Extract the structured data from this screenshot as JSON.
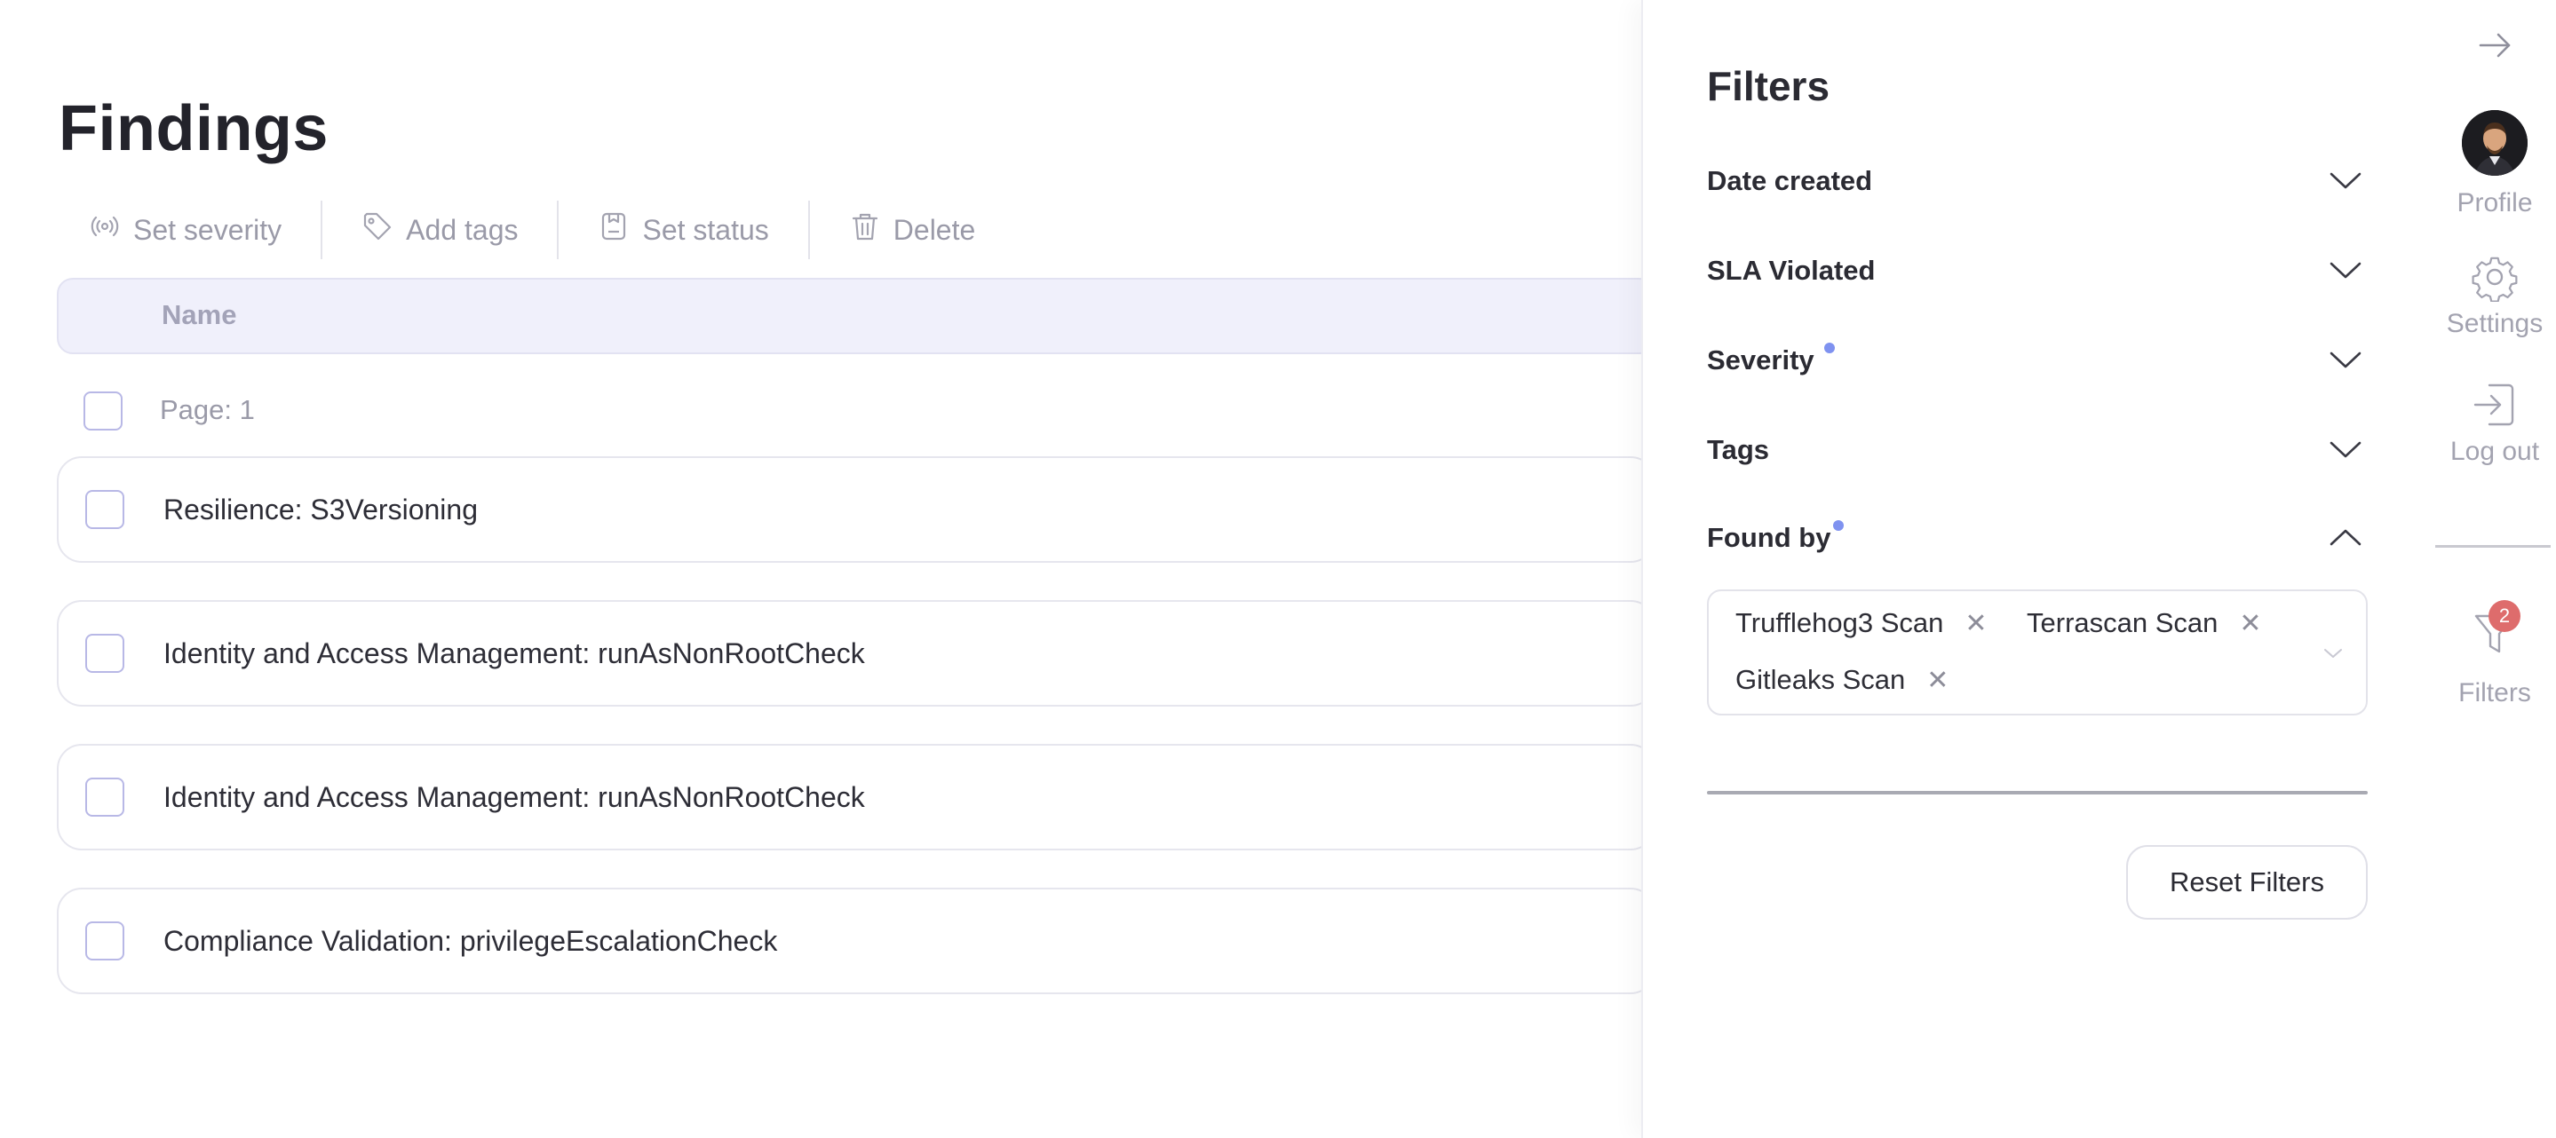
{
  "page": {
    "title": "Findings"
  },
  "toolbar": {
    "items": [
      {
        "label": "Set severity",
        "icon": "broadcast-icon"
      },
      {
        "label": "Add tags",
        "icon": "tag-icon"
      },
      {
        "label": "Set status",
        "icon": "clipboard-icon"
      },
      {
        "label": "Delete",
        "icon": "trash-icon"
      }
    ]
  },
  "table": {
    "columns": [
      "Name"
    ],
    "page_label": "Page: 1",
    "rows": [
      {
        "name": "Resilience: S3Versioning"
      },
      {
        "name": "Identity and Access Management: runAsNonRootCheck"
      },
      {
        "name": "Identity and Access Management: runAsNonRootCheck"
      },
      {
        "name": "Compliance Validation: privilegeEscalationCheck"
      }
    ]
  },
  "filters": {
    "title": "Filters",
    "sections": [
      {
        "label": "Date created",
        "active": false,
        "expanded": false
      },
      {
        "label": "SLA Violated",
        "active": false,
        "expanded": false
      },
      {
        "label": "Severity",
        "active": true,
        "expanded": false
      },
      {
        "label": "Tags",
        "active": false,
        "expanded": false
      },
      {
        "label": "Found by",
        "active": true,
        "expanded": true
      }
    ],
    "found_by_selected": [
      "Trufflehog3 Scan",
      "Terrascan Scan",
      "Gitleaks Scan"
    ],
    "reset_label": "Reset Filters"
  },
  "rail": {
    "collapse_icon": "arrow-right-icon",
    "profile_label": "Profile",
    "settings_label": "Settings",
    "logout_label": "Log out",
    "filters_label": "Filters",
    "filters_badge": "2"
  },
  "colors": {
    "accent_dot": "#7f92f0",
    "badge": "#de6c6c",
    "header_bg": "#f0f0fb",
    "checkbox_border": "#b8b8e6"
  }
}
